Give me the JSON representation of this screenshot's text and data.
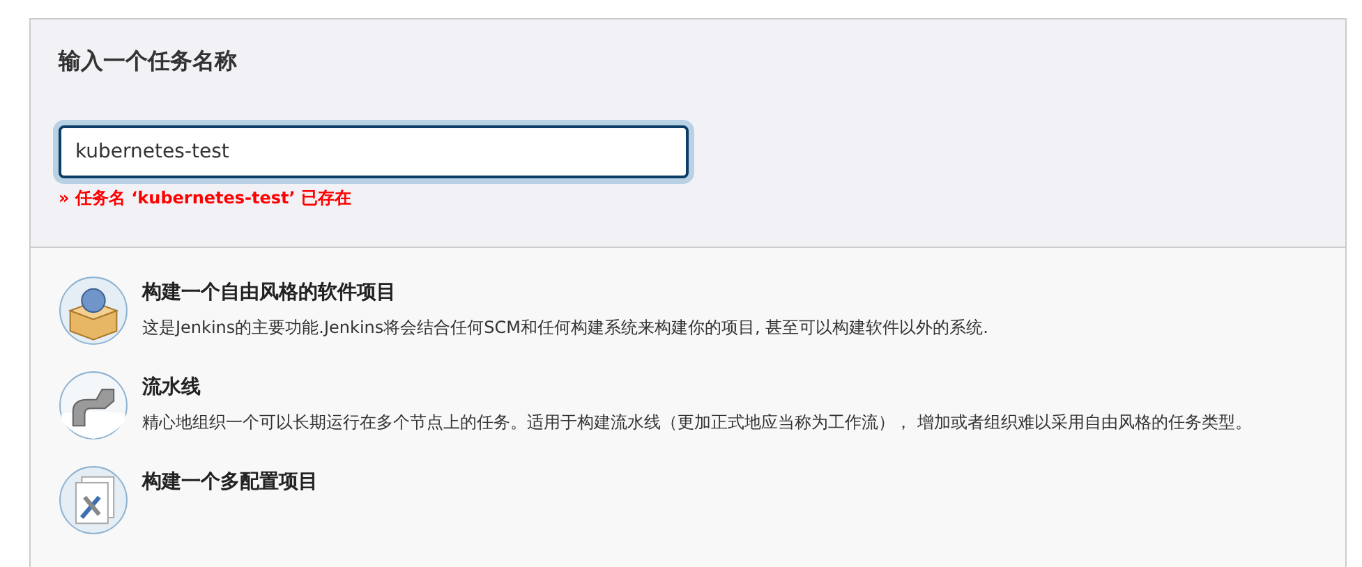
{
  "header": {
    "title": "输入一个任务名称"
  },
  "name_field": {
    "value": "kubernetes-test",
    "focused": true
  },
  "error": "» 任务名 ‘kubernetes-test’ 已存在",
  "items": [
    {
      "kind": "freestyle",
      "title": "构建一个自由风格的软件项目",
      "description": "这是Jenkins的主要功能.Jenkins将会结合任何SCM和任何构建系统来构建你的项目, 甚至可以构建软件以外的系统."
    },
    {
      "kind": "pipeline",
      "title": "流水线",
      "description": "精心地组织一个可以长期运行在多个节点上的任务。适用于构建流水线（更加正式地应当称为工作流）， 增加或者组织难以采用自由风格的任务类型。"
    },
    {
      "kind": "multiconfig",
      "title": "构建一个多配置项目"
    }
  ]
}
